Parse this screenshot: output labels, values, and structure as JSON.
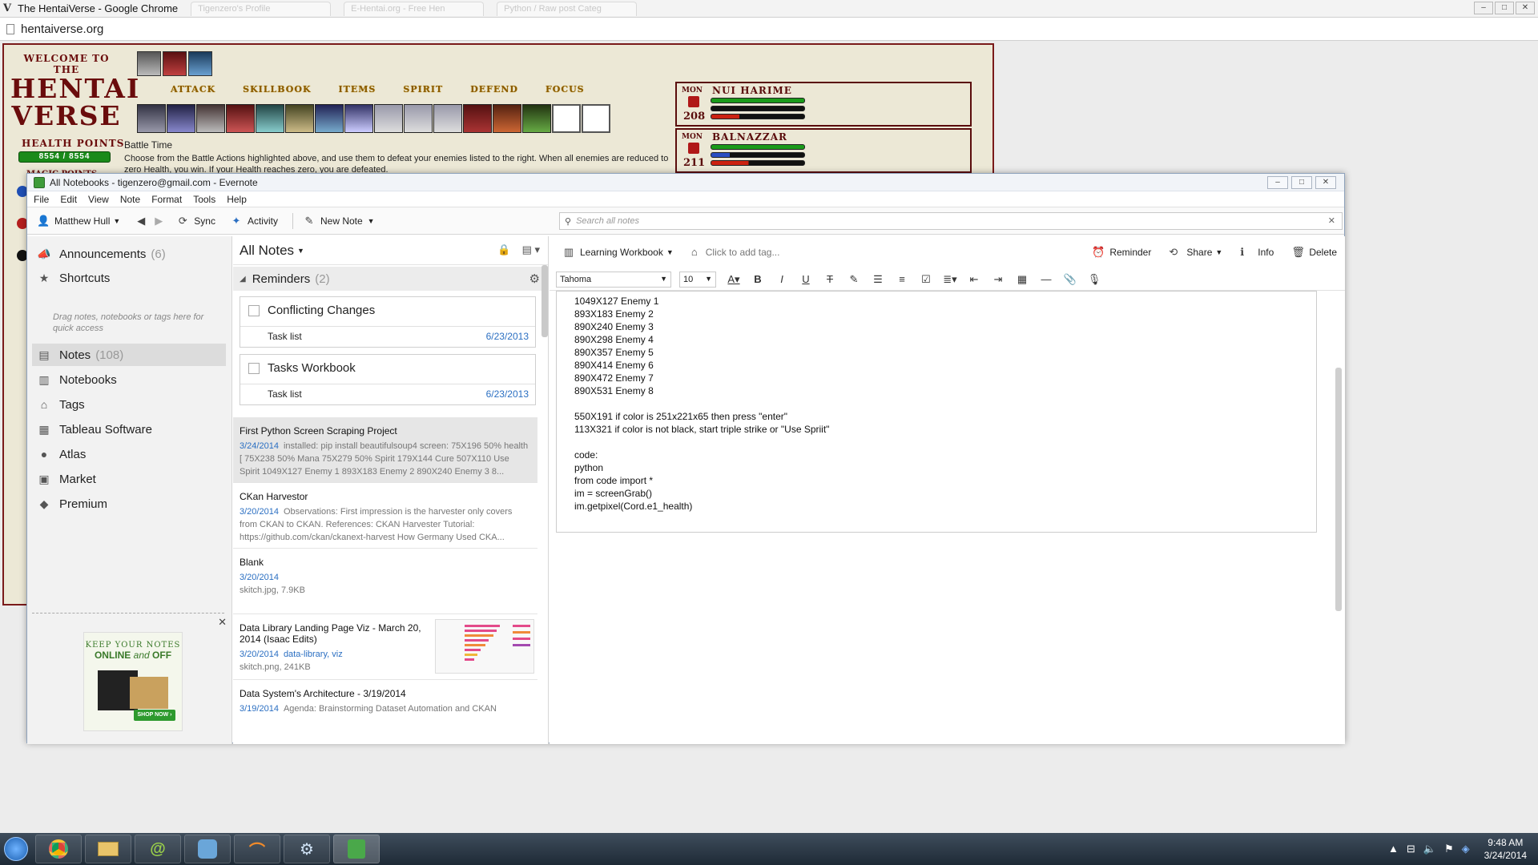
{
  "chrome": {
    "title": "The HentaiVerse - Google Chrome",
    "tabs": [
      "Tigenzero's Profile",
      "E-Hentai.org - Free Hen",
      "Python / Raw post Categ"
    ],
    "url": "hentaiverse.org"
  },
  "game": {
    "welcome": "WELCOME TO THE",
    "brand_line1": "HENTAI",
    "brand_line2": "VERSE",
    "health_label": "HEALTH POINTS",
    "health_value": "8554 / 8554",
    "magic_label": "MAGIC POINTS",
    "menu": [
      "ATTACK",
      "SKILLBOOK",
      "ITEMS",
      "SPIRIT",
      "DEFEND",
      "FOCUS"
    ],
    "battle_title": "Battle Time",
    "battle_text": "Choose from the Battle Actions highlighted above, and use them to defeat your enemies listed to the right. When all enemies are reduced to zero Health, you win. If your Health reaches zero, you are defeated.",
    "monsters": [
      {
        "label": "MON",
        "name": "NUI HARIME",
        "level": "208"
      },
      {
        "label": "MON",
        "name": "BALNAZZAR",
        "level": "211"
      }
    ]
  },
  "evernote": {
    "window_title": "All Notebooks - tigenzero@gmail.com - Evernote",
    "menu": [
      "File",
      "Edit",
      "View",
      "Note",
      "Format",
      "Tools",
      "Help"
    ],
    "toolbar": {
      "user": "Matthew Hull",
      "sync": "Sync",
      "activity": "Activity",
      "new_note": "New Note",
      "search_placeholder": "Search all notes"
    },
    "nav": {
      "announcements": "Announcements",
      "announcements_count": "(6)",
      "shortcuts": "Shortcuts",
      "shortcuts_hint": "Drag notes, notebooks or tags here for quick access",
      "notes": "Notes",
      "notes_count": "(108)",
      "notebooks": "Notebooks",
      "tags": "Tags",
      "tableau": "Tableau Software",
      "atlas": "Atlas",
      "market": "Market",
      "premium": "Premium"
    },
    "ad": {
      "line1": "KEEP YOUR NOTES",
      "line2a": "ONLINE",
      "line2b": "and",
      "line2c": "OFF",
      "button": "SHOP NOW ›"
    },
    "list": {
      "header": "All Notes",
      "reminders": "Reminders",
      "reminders_count": "(2)",
      "reminder_cards": [
        {
          "title": "Conflicting Changes",
          "sub": "Task list",
          "date": "6/23/2013"
        },
        {
          "title": "Tasks Workbook",
          "sub": "Task list",
          "date": "6/23/2013"
        }
      ],
      "notes": [
        {
          "title": "First Python Screen Scraping Project",
          "date": "3/24/2014",
          "snippet": "installed: pip install beautifulsoup4 screen: 75X196 50% health [ 75X238 50% Mana 75X279 50% Spirit 179X144 Cure 507X110 Use Spirit 1049X127 Enemy 1 893X183 Enemy 2 890X240 Enemy 3 8..."
        },
        {
          "title": "CKan Harvestor",
          "date": "3/20/2014",
          "snippet": "Observations: First impression is the harvester only covers from CKAN to CKAN. References: CKAN Harvester Tutorial: https://github.com/ckan/ckanext-harvest How Germany Used CKA..."
        },
        {
          "title": "Blank",
          "date": "3/20/2014",
          "snippet": "skitch.jpg,  7.9KB"
        },
        {
          "title": "Data Library Landing Page Viz - March 20, 2014 (Isaac Edits)",
          "date": "3/20/2014",
          "tags": "data-library, viz",
          "snippet": "skitch.png,  241KB"
        },
        {
          "title": "Data System's Architecture - 3/19/2014",
          "date": "3/19/2014",
          "snippet": "Agenda: Brainstorming Dataset Automation and CKAN"
        }
      ]
    },
    "editor": {
      "notebook": "Learning Workbook",
      "tag_placeholder": "Click to add tag...",
      "actions": {
        "reminder": "Reminder",
        "share": "Share",
        "info": "Info",
        "delete": "Delete"
      },
      "font": "Tahoma",
      "size": "10",
      "lines": [
        "1049X127 Enemy 1",
        "893X183 Enemy 2",
        "890X240 Enemy 3",
        "890X298 Enemy 4",
        "890X357 Enemy 5",
        "890X414 Enemy 6",
        "890X472 Enemy 7",
        "890X531 Enemy 8",
        "",
        "550X191 if color is 251x221x65 then press \"enter\"",
        "113X321 if color is not black, start triple strike or \"Use Spriit\"",
        "",
        "code:",
        "python",
        "from code import *",
        "im = screenGrab()",
        "im.getpixel(Cord.e1_health)"
      ]
    }
  },
  "taskbar": {
    "time": "9:48 AM",
    "date": "3/24/2014"
  }
}
